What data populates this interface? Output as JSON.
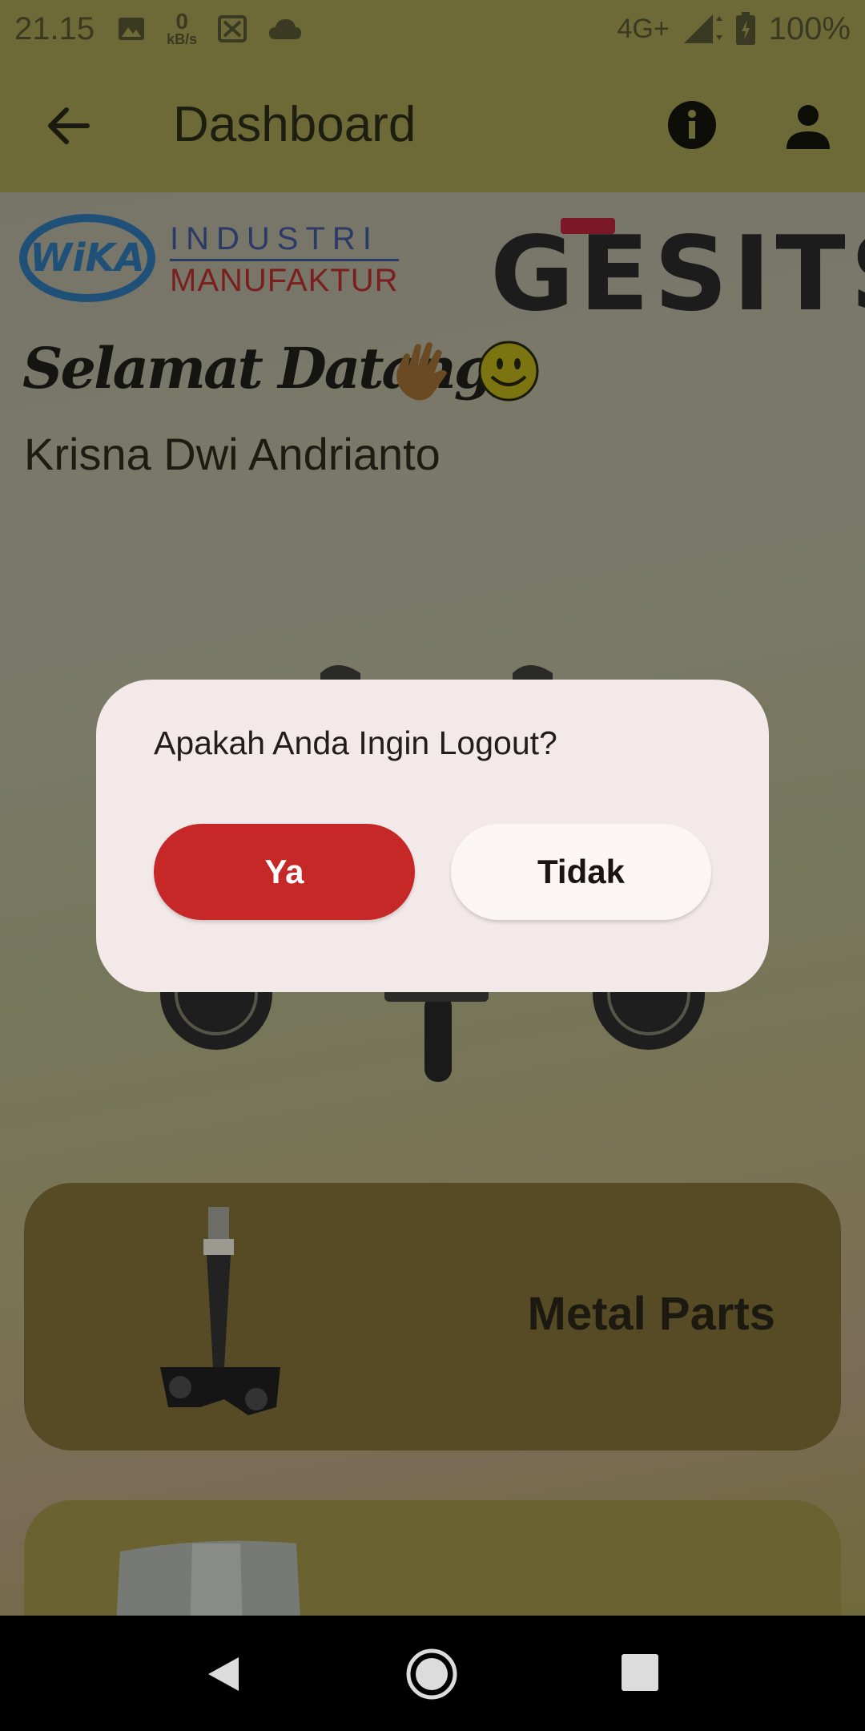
{
  "status_bar": {
    "time": "21.15",
    "net_speed_value": "0",
    "net_speed_unit": "kB/s",
    "network": "4G+",
    "battery": "100%",
    "icons": [
      "image-icon",
      "speed-icon",
      "app-icon",
      "cloud-icon",
      "signal-icon",
      "battery-charging-icon"
    ]
  },
  "app_bar": {
    "title": "Dashboard",
    "back_icon": "arrow-back-icon",
    "info_icon": "info-icon",
    "profile_icon": "person-icon"
  },
  "header": {
    "wika_logo": "WiKA",
    "industri_line1": "INDUSTRI",
    "industri_line2": "MANUFAKTUR",
    "brand_logo": "GESITS",
    "welcome_text": "Selamat Datang,",
    "user_name": "Krisna Dwi Andrianto"
  },
  "cards": [
    {
      "label": "Metal Parts"
    },
    {
      "label": ""
    }
  ],
  "dialog": {
    "message": "Apakah Anda Ingin Logout?",
    "confirm_label": "Ya",
    "cancel_label": "Tidak",
    "confirm_color": "#c62828"
  },
  "nav_bar": {
    "icons": [
      "nav-back-icon",
      "nav-home-icon",
      "nav-recent-icon"
    ]
  }
}
